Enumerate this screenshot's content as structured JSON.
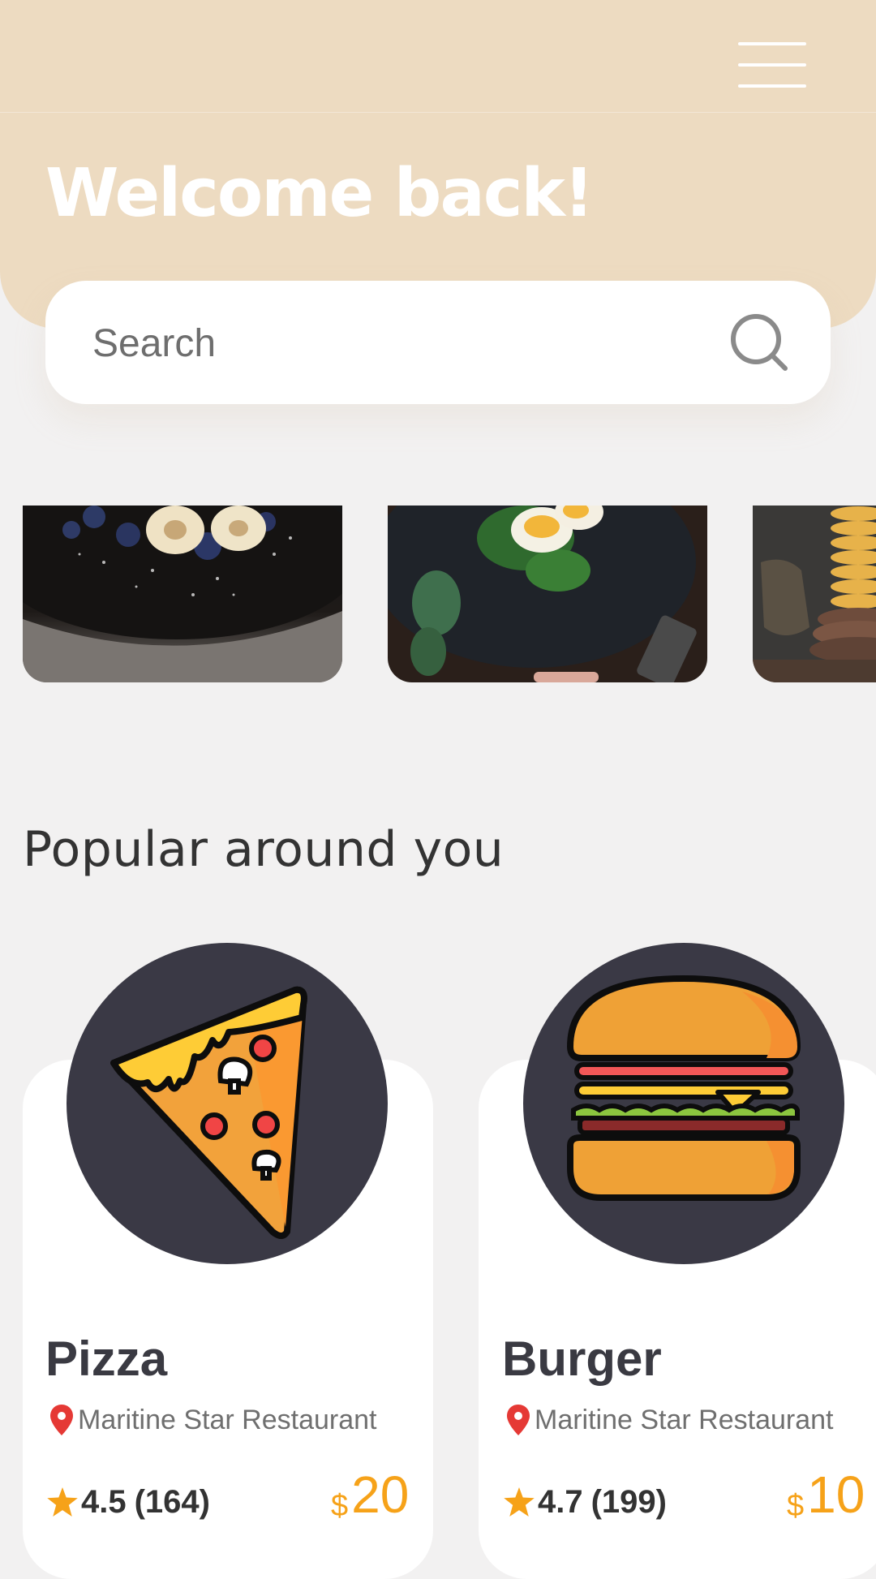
{
  "header": {
    "title": "Welcome back!",
    "background_color": "#eddbc1",
    "menu_icon": "hamburger-menu-icon"
  },
  "search": {
    "placeholder": "Search",
    "icon": "search-icon"
  },
  "carousel": {
    "items": [
      {
        "name": "blueberry-banana-dessert"
      },
      {
        "name": "egg-spinach-salad"
      },
      {
        "name": "pancake-stack"
      }
    ]
  },
  "popular": {
    "title": "Popular around you",
    "items": [
      {
        "name": "Pizza",
        "restaurant": "Maritine Star Restaurant",
        "rating": "4.5",
        "reviews": "(164)",
        "currency": "$",
        "price": "20",
        "icon": "pizza-slice-icon"
      },
      {
        "name": "Burger",
        "restaurant": "Maritine Star Restaurant",
        "rating": "4.7",
        "reviews": "(199)",
        "currency": "$",
        "price": "10",
        "icon": "burger-icon"
      }
    ]
  },
  "colors": {
    "accent": "#f6a219",
    "pin": "#e53935",
    "circle": "#3a3945"
  }
}
